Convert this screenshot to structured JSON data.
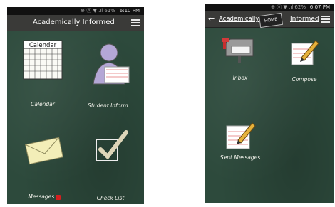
{
  "screen1": {
    "status": {
      "time": "6:10 PM",
      "indicators": "⊕ ⓝ ▼ .ıl 61%"
    },
    "title": "Academically Informed",
    "tiles": [
      {
        "label": "Calendar",
        "header": "Calendar",
        "icon": "calendar-icon"
      },
      {
        "label": "Student Inform...",
        "icon": "student-icon"
      },
      {
        "label": "Messages",
        "badge": "!",
        "icon": "envelope-icon"
      },
      {
        "label": "Check List",
        "icon": "checklist-icon"
      }
    ]
  },
  "screen2": {
    "status": {
      "time": "6:07 PM",
      "indicators": "⊕ ⓝ ▼ .ıl 62%"
    },
    "title_left": "Academically",
    "title_right": "Informed",
    "home_label": "HOME",
    "tiles": [
      {
        "label": "Inbox",
        "icon": "mailbox-icon"
      },
      {
        "label": "Compose",
        "icon": "compose-icon"
      },
      {
        "label": "Sent Messages",
        "icon": "sent-icon"
      }
    ]
  }
}
